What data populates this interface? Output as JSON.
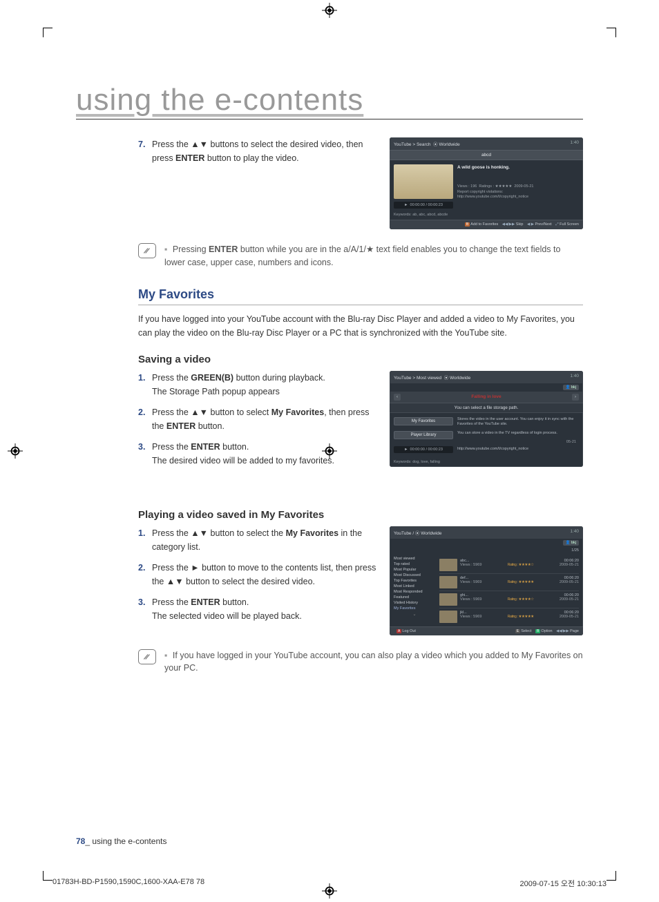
{
  "header_title": "using the e-contents",
  "step7": {
    "num": "7.",
    "text_before": "Press the ",
    "text_arrows": "▲▼",
    "text_mid": " buttons to select the desired video, then press ",
    "enter": "ENTER",
    "text_after": " button to play the video."
  },
  "mock1": {
    "breadcrumb": "YouTube > Search",
    "region_icon": "⦿",
    "region": "Worldwide",
    "time_header": "1:40",
    "search_term": "abcd",
    "title": "A wild goose is honking.",
    "views_label": "Views : 196",
    "ratings_label": "Ratings : ★★★★★",
    "date": "2009-05-21",
    "report": "Report copyright violations:",
    "url": "http://www.youtube.com/t/copyright_notice",
    "play_time": "00:00:00 / 00:00:23",
    "keywords_label": "Keywords: ab, abc, abcd, abcde",
    "footer": [
      {
        "key": "B",
        "label": "Add to Favorites"
      },
      {
        "key": "◀◀/▶▶",
        "label": "Skip"
      },
      {
        "key": "◀ ▶",
        "label": "Prev/Next"
      },
      {
        "key": "⤢",
        "label": "Full Screen"
      }
    ]
  },
  "note1_text": "Pressing ENTER button while you are in the a/A/1/★ text field enables you to change the text fields to lower case, upper case, numbers and icons.",
  "note1_enter": "ENTER",
  "my_favorites_h": "My Favorites",
  "my_favorites_p": "If you have logged into your YouTube account with the Blu-ray Disc Player and added a video to My Favorites, you can play the video on the Blu-ray Disc Player or a PC that is synchronized with the YouTube site.",
  "saving_h": "Saving a video",
  "save_steps": {
    "s1_num": "1.",
    "s1_a": "Press the ",
    "s1_green": "GREEN(B)",
    "s1_b": " button during playback.",
    "s1_c": "The Storage Path popup appears",
    "s2_num": "2.",
    "s2_a": "Press the ",
    "s2_arrows": "▲▼",
    "s2_b": " button to select ",
    "s2_target": "My Favorites",
    "s2_c": ", then press the ",
    "s2_enter": "ENTER",
    "s2_d": " button.",
    "s3_num": "3.",
    "s3_a": "Press the ",
    "s3_enter": "ENTER",
    "s3_b": " button.",
    "s3_c": "The desired video will be added to my favorites."
  },
  "mock2": {
    "breadcrumb": "YouTube > Most viewed",
    "region": "Worldwide",
    "time_header": "1:40",
    "user": "bkj",
    "arrow_title": "Falling in love",
    "popup_title": "You can select a file storage path.",
    "opt1": "My Favorites",
    "opt1_desc": "Stores the video in the user account. You can enjoy it in sync with the Favorites of the YouTube site.",
    "opt2": "Player Library",
    "opt2_desc": "You can store a video in the TV regardless of login process.",
    "side_date": "05-21",
    "url": "http://www.youtube.com/t/copyright_notice",
    "play_time": "00:00:00 / 00:00:23",
    "keywords_label": "Keywords: dog, love, falling"
  },
  "playing_h": "Playing a video saved in My Favorites",
  "play_steps": {
    "s1_num": "1.",
    "s1_a": "Press the ",
    "s1_arrows": "▲▼",
    "s1_b": " button to select the ",
    "s1_target": "My Favorites",
    "s1_c": " in the category list.",
    "s2_num": "2.",
    "s2_a": "Press the ",
    "s2_arrow": "►",
    "s2_b": " button to move to the contents list, then press the ",
    "s2_arrows": "▲▼",
    "s2_c": " button to select the desired video.",
    "s3_num": "3.",
    "s3_a": "Press the ",
    "s3_enter": "ENTER",
    "s3_b": " button.",
    "s3_c": "The selected video will be played back."
  },
  "mock3": {
    "breadcrumb": "YouTube /",
    "region": "Worldwide",
    "time_header": "1:40",
    "user": "bkj",
    "count": "1/25",
    "sidebar": [
      "Most viewed",
      "Top rated",
      "Most Popular",
      "Most Discussed",
      "Top Favorites",
      "Most Linked",
      "Most Responded",
      "Featured",
      "Visited History",
      "My Favorites"
    ],
    "items": [
      {
        "title": "abc...",
        "views": "Views : 5969",
        "rating": "Rating : ★★★★☆",
        "dur": "00:06:20",
        "date": "2009-05-21"
      },
      {
        "title": "def...",
        "views": "Views : 5969",
        "rating": "Rating : ★★★★★",
        "dur": "00:06:20",
        "date": "2009-05-21"
      },
      {
        "title": "ghi...",
        "views": "Views : 5969",
        "rating": "Rating : ★★★★☆",
        "dur": "00:06:20",
        "date": "2009-05-21"
      },
      {
        "title": "jkl...",
        "views": "Views : 5969",
        "rating": "Rating : ★★★★★",
        "dur": "00:06:20",
        "date": "2009-05-21"
      }
    ],
    "footer": [
      {
        "key": "A",
        "label": "Log Out"
      },
      {
        "key": "E",
        "label": "Select"
      },
      {
        "key": "B",
        "label": "Option"
      },
      {
        "key": "◀◀/▶▶",
        "label": "Page"
      }
    ]
  },
  "note2_text": "If you have logged in your YouTube account, you can also play a video which you added to My Favorites on your PC.",
  "footer_page": "78",
  "footer_text": "using the e-contents",
  "print_file": "01783H-BD-P1590,1590C,1600-XAA-E78   78",
  "print_date": "2009-07-15   오전 10:30:13"
}
